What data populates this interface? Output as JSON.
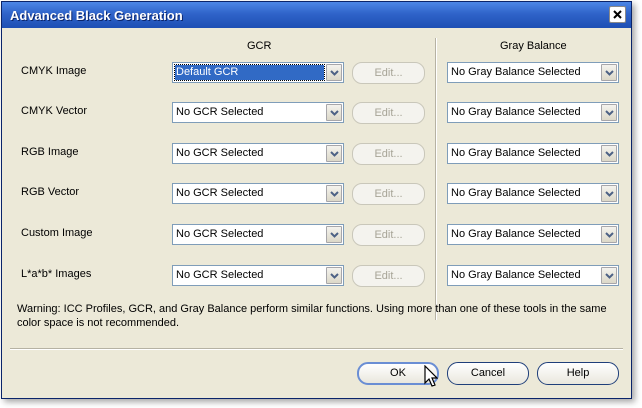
{
  "window": {
    "title": "Advanced Black Generation"
  },
  "headers": {
    "gcr": "GCR",
    "gray_balance": "Gray Balance"
  },
  "rows": [
    {
      "label": "CMYK Image",
      "gcr": "Default GCR",
      "edit": "Edit...",
      "gray": "No Gray Balance Selected"
    },
    {
      "label": "CMYK Vector",
      "gcr": "No GCR Selected",
      "edit": "Edit...",
      "gray": "No Gray Balance Selected"
    },
    {
      "label": "RGB Image",
      "gcr": "No GCR Selected",
      "edit": "Edit...",
      "gray": "No Gray Balance Selected"
    },
    {
      "label": "RGB Vector",
      "gcr": "No GCR Selected",
      "edit": "Edit...",
      "gray": "No Gray Balance Selected"
    },
    {
      "label": "Custom Image",
      "gcr": "No GCR Selected",
      "edit": "Edit...",
      "gray": "No Gray Balance Selected"
    },
    {
      "label": "L*a*b* Images",
      "gcr": "No GCR Selected",
      "edit": "Edit...",
      "gray": "No Gray Balance Selected"
    }
  ],
  "warning": "Warning: ICC Profiles, GCR, and Gray Balance perform similar functions.  Using more than one of these tools in the same color space is not recommended.",
  "buttons": {
    "ok": "OK",
    "cancel": "Cancel",
    "help": "Help"
  },
  "colors": {
    "titlebar": "#2f63c9",
    "dialog_bg": "#ece9d8",
    "selection": "#316ac5"
  }
}
